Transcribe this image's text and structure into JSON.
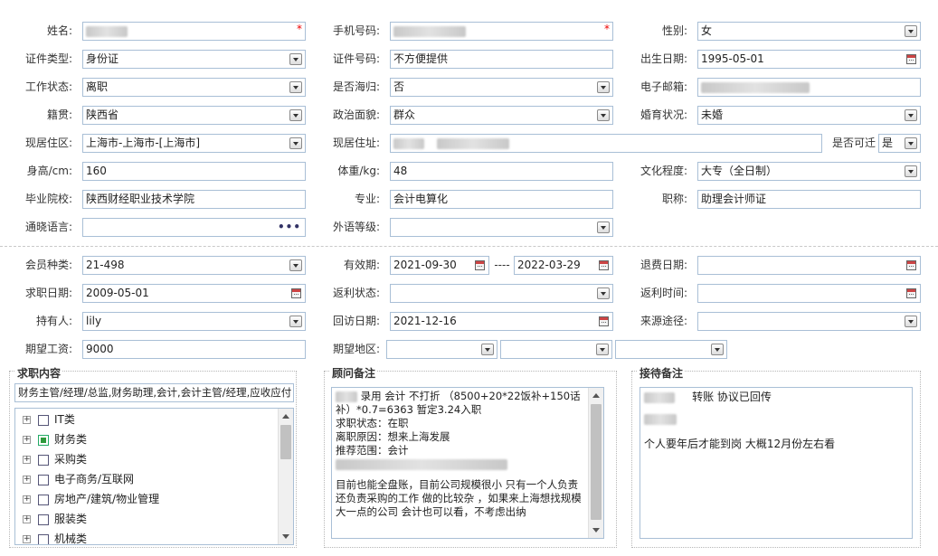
{
  "form": {
    "name_label": "姓名:",
    "phone_label": "手机号码:",
    "gender_label": "性别:",
    "gender_value": "女",
    "idtype_label": "证件类型:",
    "idtype_value": "身份证",
    "idno_label": "证件号码:",
    "idno_value": "不方便提供",
    "birth_label": "出生日期:",
    "birth_value": "1995-05-01",
    "workstatus_label": "工作状态:",
    "workstatus_value": "离职",
    "overseas_label": "是否海归:",
    "overseas_value": "否",
    "email_label": "电子邮箱:",
    "native_label": "籍贯:",
    "native_value": "陕西省",
    "political_label": "政治面貌:",
    "political_value": "群众",
    "marital_label": "婚育状况:",
    "marital_value": "未婚",
    "region_label": "现居住区:",
    "region_value": "上海市-上海市-[上海市]",
    "address_label": "现居住址:",
    "relocate_label": "是否可迁",
    "relocate_value": "是",
    "height_label": "身高/cm:",
    "height_value": "160",
    "weight_label": "体重/kg:",
    "weight_value": "48",
    "education_label": "文化程度:",
    "education_value": "大专（全日制）",
    "school_label": "毕业院校:",
    "school_value": "陕西财经职业技术学院",
    "major_label": "专业:",
    "major_value": "会计电算化",
    "title_label": "职称:",
    "title_value": "助理会计师证",
    "language_label": "通晓语言:",
    "language_ellipsis": "•••",
    "foreign_label": "外语等级:"
  },
  "member": {
    "type_label": "会员种类:",
    "type_value": "21-498",
    "valid_label": "有效期:",
    "valid_from": "2021-09-30",
    "valid_sep": "----",
    "valid_to": "2022-03-29",
    "refund_label": "退费日期:",
    "jobdate_label": "求职日期:",
    "jobdate_value": "2009-05-01",
    "rebate_status_label": "返利状态:",
    "rebate_time_label": "返利时间:",
    "holder_label": "持有人:",
    "holder_value": "lily",
    "visit_label": "回访日期:",
    "visit_value": "2021-12-16",
    "source_label": "来源途径:",
    "salary_label": "期望工资:",
    "salary_value": "9000",
    "area_label": "期望地区:"
  },
  "job": {
    "title": "求职内容",
    "summary": "财务主管/经理/总监,财务助理,会计,会计主管/经理,应收应付",
    "categories": [
      {
        "label": "IT类",
        "checked": false
      },
      {
        "label": "财务类",
        "checked": true
      },
      {
        "label": "采购类",
        "checked": false
      },
      {
        "label": "电子商务/互联网",
        "checked": false
      },
      {
        "label": "房地产/建筑/物业管理",
        "checked": false
      },
      {
        "label": "服装类",
        "checked": false
      },
      {
        "label": "机械类",
        "checked": false
      }
    ]
  },
  "advisor": {
    "title": "顾问备注",
    "line1": "录用 会计 不打折 （8500+20*22饭补+150话补）*0.7=6363 暂定3.24入职",
    "line2": "求职状态：在职",
    "line3": "离职原因：想来上海发展",
    "line4": "推荐范围：会计",
    "line5": "目前也能全盘账，目前公司规模很小 只有一个人负责 还负责采购的工作 做的比较杂 ，如果来上海想找规模大一点的公司  会计也可以看，不考虑出纳"
  },
  "reception": {
    "title": "接待备注",
    "line1": "转账 协议已回传",
    "line2": "个人要年后才能到岗  大概12月份左右看"
  },
  "colors": {
    "border": "#a9bfd6",
    "required": "#e00000",
    "checked": "#2e9a3c"
  }
}
